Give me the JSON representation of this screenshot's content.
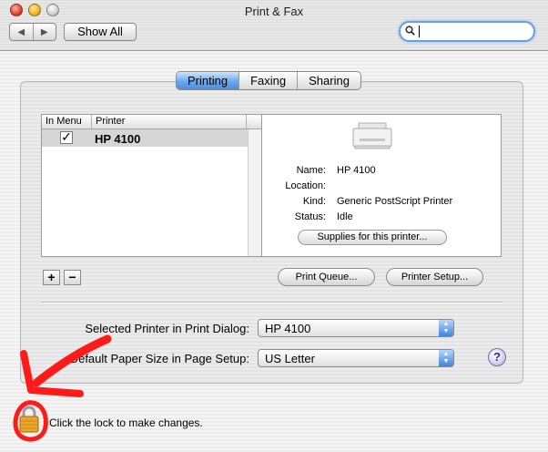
{
  "window": {
    "title": "Print & Fax"
  },
  "toolbar": {
    "back_glyph": "◀",
    "forward_glyph": "▶",
    "show_all_label": "Show All",
    "search_placeholder": "",
    "search_value": "",
    "search_icon": "magnifier-icon"
  },
  "tabs": [
    {
      "label": "Printing",
      "active": true
    },
    {
      "label": "Faxing",
      "active": false
    },
    {
      "label": "Sharing",
      "active": false
    }
  ],
  "printer_list": {
    "columns": [
      "In Menu",
      "Printer"
    ],
    "rows": [
      {
        "in_menu": true,
        "check_glyph": "✓",
        "name": "HP 4100",
        "selected": true
      }
    ]
  },
  "details": {
    "icon": "printer-icon",
    "fields": [
      {
        "label": "Name:",
        "value": "HP 4100"
      },
      {
        "label": "Location:",
        "value": ""
      },
      {
        "label": "Kind:",
        "value": "Generic PostScript Printer"
      },
      {
        "label": "Status:",
        "value": "Idle"
      }
    ],
    "supplies_label": "Supplies for this printer..."
  },
  "list_controls": {
    "add_label": "+",
    "remove_label": "−"
  },
  "buttons": {
    "print_queue": "Print Queue...",
    "printer_setup": "Printer Setup..."
  },
  "selected_printer": {
    "label": "Selected Printer in Print Dialog:",
    "value": "HP 4100"
  },
  "paper_size": {
    "label": "Default Paper Size in Page Setup:",
    "value": "US Letter"
  },
  "help": {
    "label": "?"
  },
  "lock": {
    "text": "Click the lock to make changes.",
    "icon": "padlock-icon"
  },
  "annotation": {
    "color": "#ff0000",
    "shapes": "hand-drawn-arrow-and-circle"
  },
  "colors": {
    "accent": "#4a8fdf",
    "lock": "#e0a020"
  }
}
